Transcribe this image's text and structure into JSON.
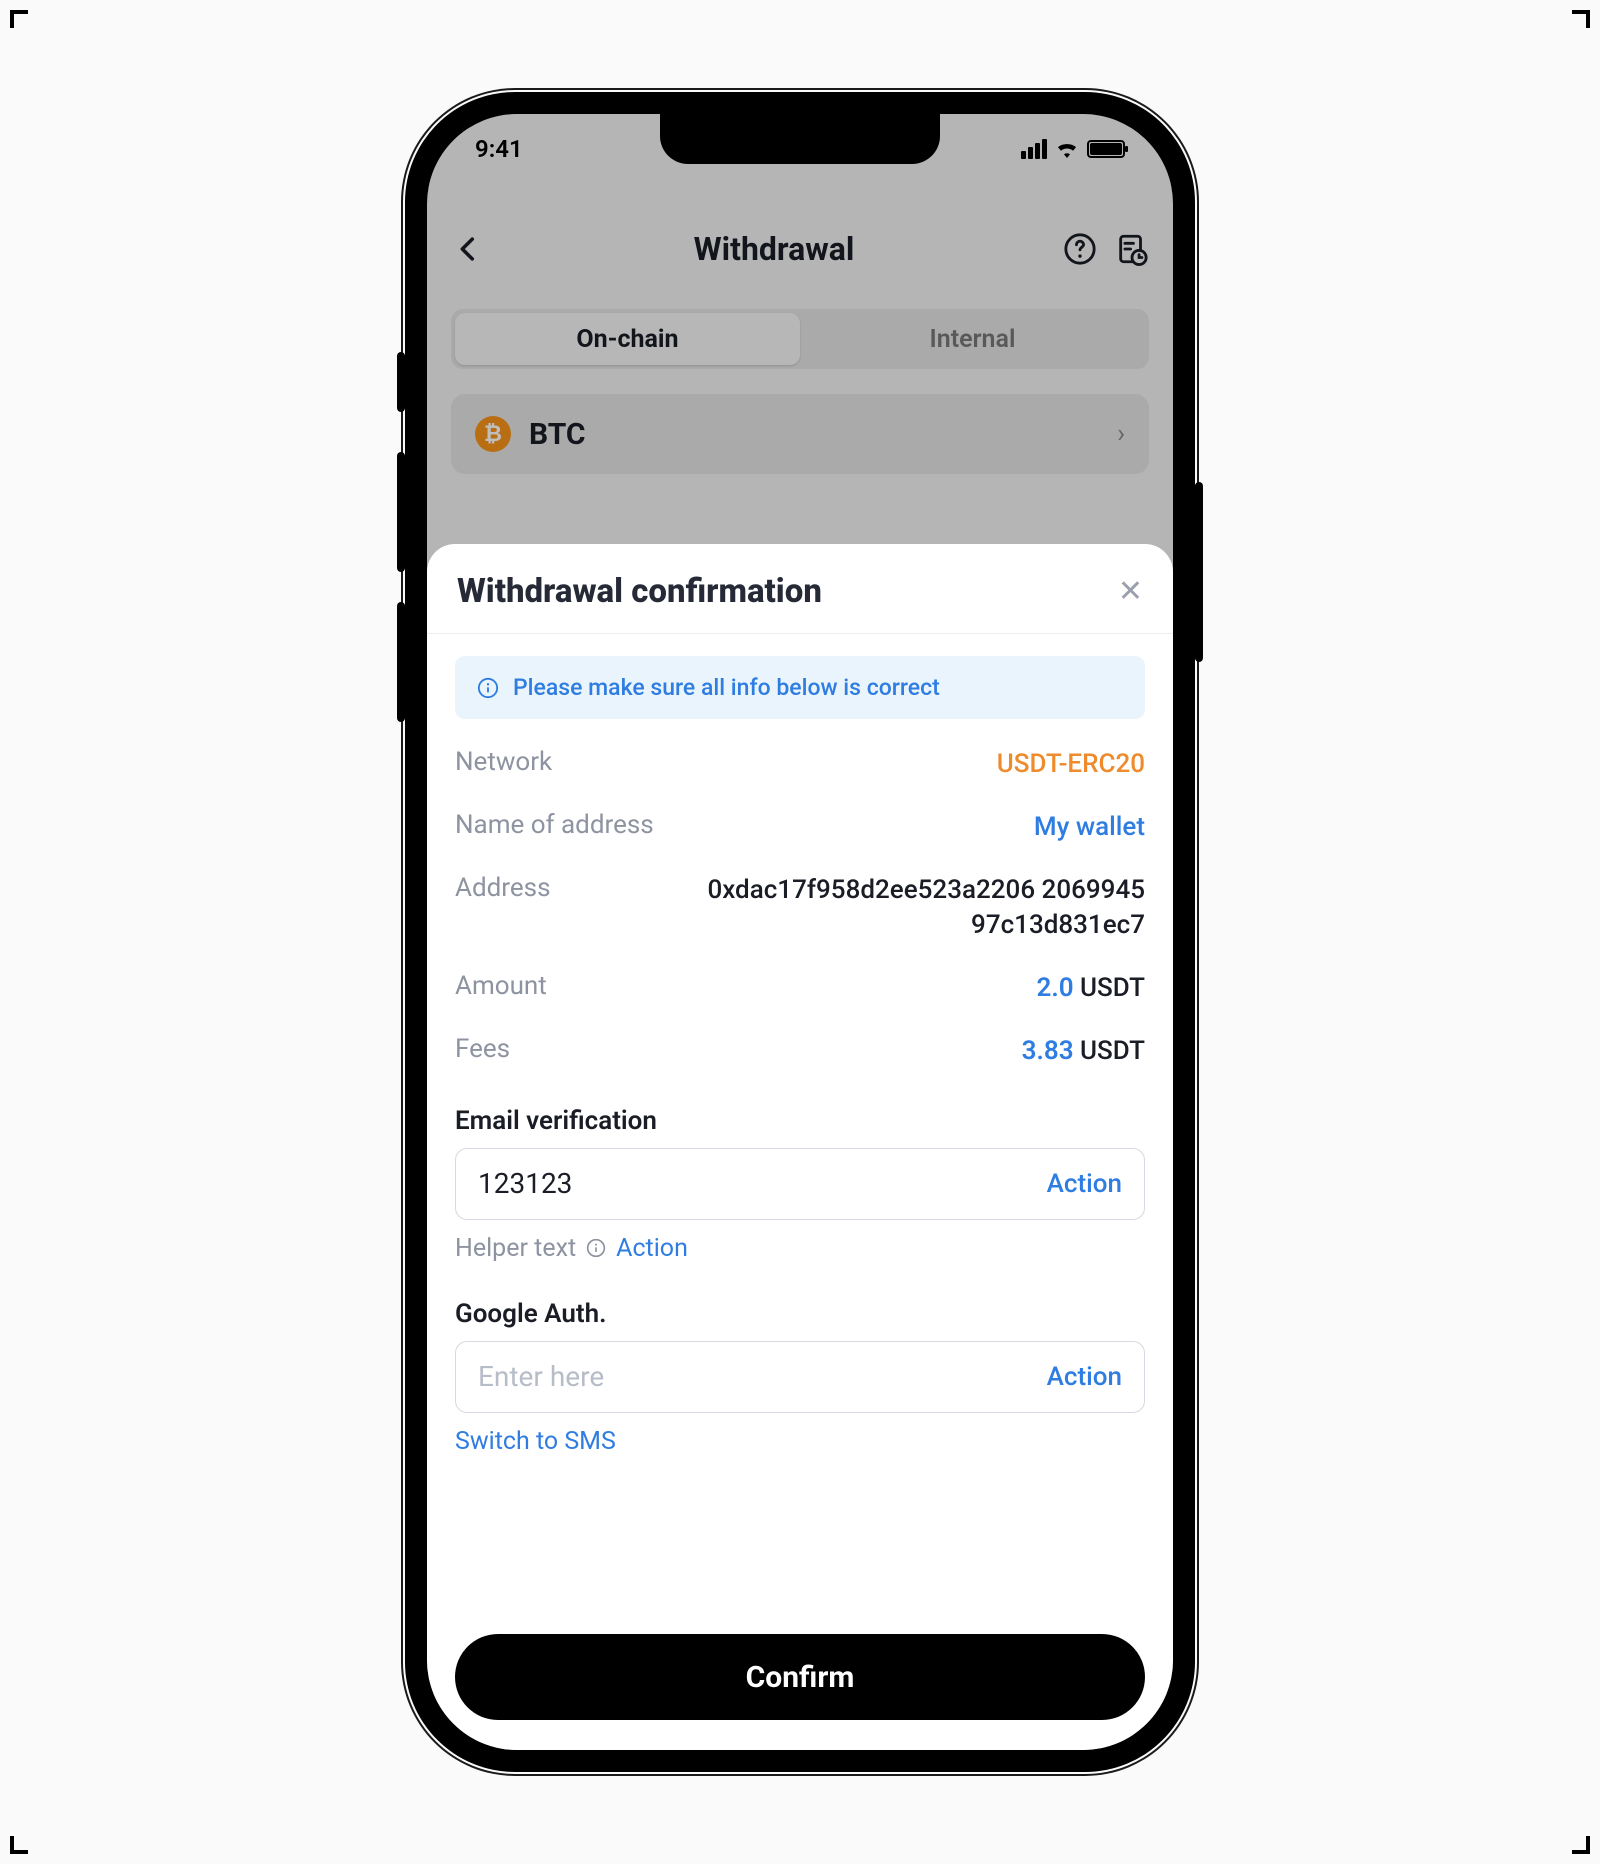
{
  "status": {
    "time": "9:41"
  },
  "nav": {
    "title": "Withdrawal"
  },
  "tabs": {
    "onchain": "On-chain",
    "internal": "Internal"
  },
  "coin": {
    "symbol_letter": "₿",
    "symbol": "BTC"
  },
  "sheet": {
    "title": "Withdrawal confirmation",
    "banner": "Please make sure all info below is correct",
    "rows": {
      "network_label": "Network",
      "network_value": "USDT-ERC20",
      "name_label": "Name of address",
      "name_value": "My wallet",
      "address_label": "Address",
      "address_value": "0xdac17f958d2ee523a2206 206994597c13d831ec7",
      "amount_label": "Amount",
      "amount_value": "2.0",
      "amount_ccy": " USDT",
      "fees_label": "Fees",
      "fees_value": "3.83",
      "fees_ccy": " USDT"
    },
    "email": {
      "label": "Email verification",
      "value": "123123",
      "action": "Action",
      "helper_text": "Helper text",
      "helper_action": "Action"
    },
    "google": {
      "label": "Google Auth.",
      "placeholder": "Enter here",
      "action": "Action",
      "switch": "Switch to SMS"
    },
    "confirm": "Confirm"
  }
}
